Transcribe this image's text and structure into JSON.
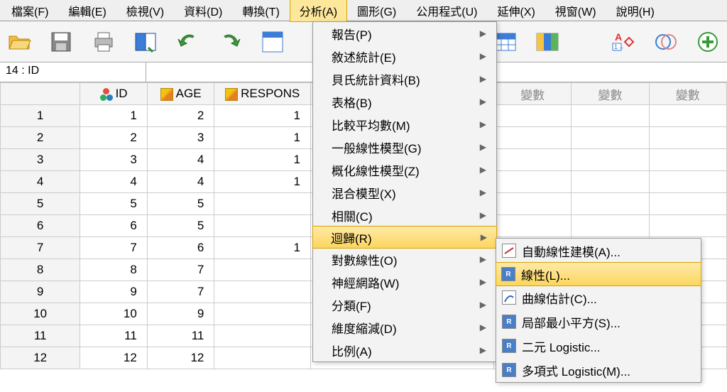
{
  "menubar": {
    "file": "檔案(F)",
    "edit": "編輯(E)",
    "view": "檢視(V)",
    "data": "資料(D)",
    "transform": "轉換(T)",
    "analyze": "分析(A)",
    "graphs": "圖形(G)",
    "utilities": "公用程式(U)",
    "extensions": "延伸(X)",
    "window": "視窗(W)",
    "help": "說明(H)"
  },
  "refbar": {
    "cell": "14 : ID"
  },
  "columns": {
    "id": "ID",
    "age": "AGE",
    "response": "RESPONS",
    "var": "變數"
  },
  "rows": [
    {
      "n": "1",
      "id": "1",
      "age": "2",
      "resp": "1"
    },
    {
      "n": "2",
      "id": "2",
      "age": "3",
      "resp": "1"
    },
    {
      "n": "3",
      "id": "3",
      "age": "4",
      "resp": "1"
    },
    {
      "n": "4",
      "id": "4",
      "age": "4",
      "resp": "1"
    },
    {
      "n": "5",
      "id": "5",
      "age": "5",
      "resp": ""
    },
    {
      "n": "6",
      "id": "6",
      "age": "5",
      "resp": ""
    },
    {
      "n": "7",
      "id": "7",
      "age": "6",
      "resp": "1"
    },
    {
      "n": "8",
      "id": "8",
      "age": "7",
      "resp": ""
    },
    {
      "n": "9",
      "id": "9",
      "age": "7",
      "resp": ""
    },
    {
      "n": "10",
      "id": "10",
      "age": "9",
      "resp": ""
    },
    {
      "n": "11",
      "id": "11",
      "age": "11",
      "resp": ""
    },
    {
      "n": "12",
      "id": "12",
      "age": "12",
      "resp": ""
    }
  ],
  "analyze_menu": {
    "reports": "報告(P)",
    "descriptives": "敘述統計(E)",
    "bayesian": "貝氏統計資料(B)",
    "tables": "表格(B)",
    "compare_means": "比較平均數(M)",
    "glm": "一般線性模型(G)",
    "genlin": "概化線性模型(Z)",
    "mixed": "混合模型(X)",
    "correlate": "相關(C)",
    "regression": "迴歸(R)",
    "loglinear": "對數線性(O)",
    "neural": "神經網路(W)",
    "classify": "分類(F)",
    "dimred": "維度縮減(D)",
    "scale": "比例(A)"
  },
  "regression_submenu": {
    "auto_linear": "自動線性建模(A)...",
    "linear": "線性(L)...",
    "curve": "曲線估計(C)...",
    "pls": "局部最小平方(S)...",
    "binlog": "二元 Logistic...",
    "multilog": "多項式 Logistic(M)..."
  }
}
